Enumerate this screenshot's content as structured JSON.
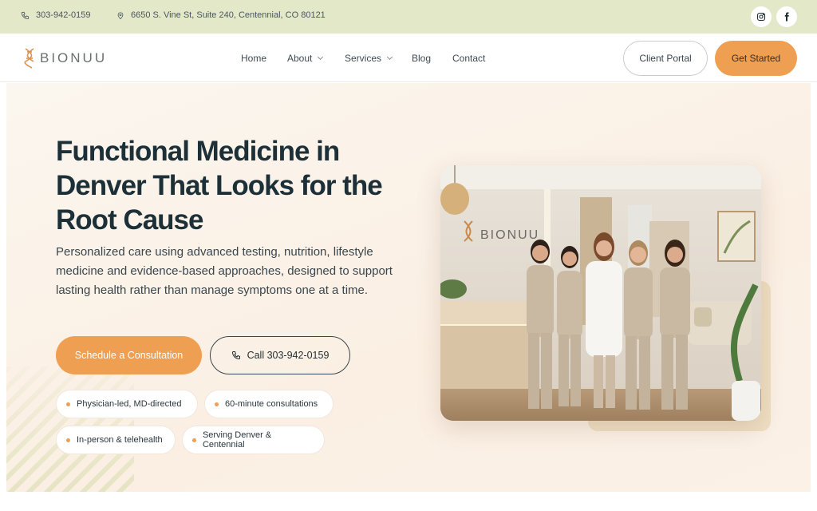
{
  "topbar": {
    "phone": "303-942-0159",
    "address": "6650 S. Vine St, Suite 240, Centennial, CO 80121",
    "phone_icon": "phone-icon",
    "location_icon": "map-pin-icon",
    "social": [
      "instagram-icon",
      "facebook-icon"
    ]
  },
  "brand": {
    "name": "BIONUU",
    "logo_icon": "dna-icon"
  },
  "nav": {
    "home": "Home",
    "about": "About",
    "services": "Services",
    "blog": "Blog",
    "contact": "Contact"
  },
  "header": {
    "client_portal": "Client Portal",
    "get_started": "Get Started"
  },
  "hero": {
    "title": "Functional Medicine in Denver That Looks for the Root Cause",
    "subtitle": "Personalized care using advanced testing, nutrition, lifestyle medicine and evidence-based approaches, designed to support lasting health rather than manage symptoms one at a time.",
    "cta_primary": "Schedule a Consultation",
    "cta_call": "Call 303-942-0159",
    "badges": [
      "Physician-led, MD-directed",
      "60-minute consultations",
      "In-person & telehealth",
      "Serving Denver & Centennial"
    ],
    "photo_sign": "BIONUU"
  },
  "colors": {
    "accent": "#ef9f52",
    "topbar": "#e3e9c8",
    "heading": "#1d3038"
  }
}
